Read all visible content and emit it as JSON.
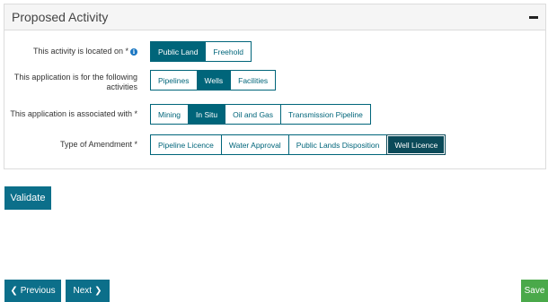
{
  "panel": {
    "title": "Proposed Activity",
    "collapse_icon": "minus-icon"
  },
  "rows": [
    {
      "label": "This activity is located on *",
      "info_icon": "i",
      "options": [
        "Public Land",
        "Freehold"
      ],
      "selected": "Public Land"
    },
    {
      "label": "This application is for the following activities",
      "options": [
        "Pipelines",
        "Wells",
        "Facilities"
      ],
      "selected": "Wells"
    },
    {
      "label": "This application is associated with *",
      "options": [
        "Mining",
        "In Situ",
        "Oil and Gas",
        "Transmission Pipeline"
      ],
      "selected": "In Situ"
    },
    {
      "label": "Type of Amendment *",
      "options": [
        "Pipeline Licence",
        "Water Approval",
        "Public Lands Disposition",
        "Well Licence"
      ],
      "selected": "Well Licence"
    }
  ],
  "actions": {
    "validate": "Validate",
    "previous": "Previous",
    "next": "Next",
    "save": "Save",
    "previous_icon": "chevron-left-icon",
    "next_icon": "chevron-right-icon"
  },
  "colors": {
    "primary": "#00657a",
    "button": "#0c6f8a",
    "save": "#4aa94a",
    "info": "#1b77c2"
  }
}
